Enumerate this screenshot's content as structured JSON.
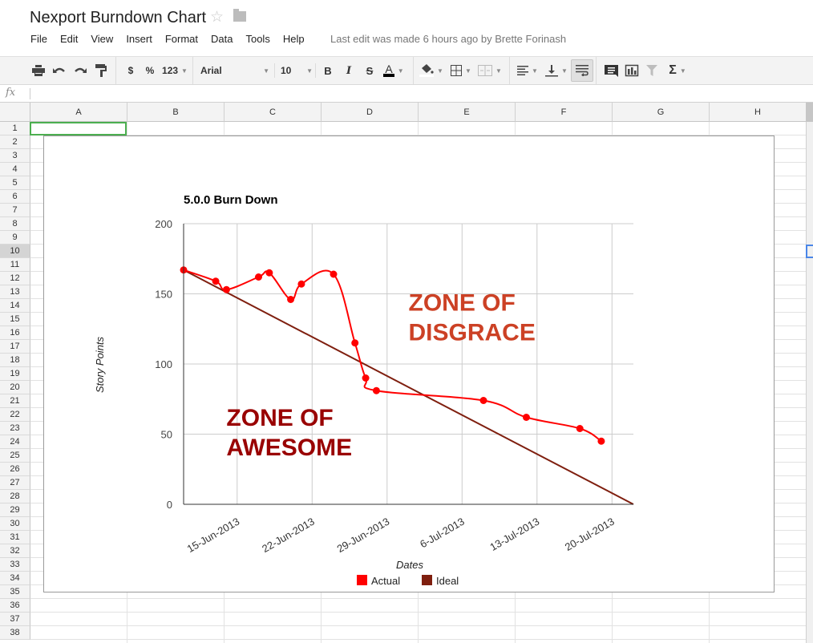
{
  "app": {
    "title": "Nexport Burndown Chart",
    "star_icon": "☆",
    "last_edit": "Last edit was made 6 hours ago by Brette Forinash"
  },
  "menu": [
    "File",
    "Edit",
    "View",
    "Insert",
    "Format",
    "Data",
    "Tools",
    "Help"
  ],
  "toolbar": {
    "currency": "$",
    "percent": "%",
    "number_format": "123",
    "font": "Arial",
    "font_size": "10",
    "bold": "B",
    "italic": "I",
    "strike": "S",
    "text_color": "A",
    "sigma": "Σ"
  },
  "formula_bar": {
    "fx_label": "fx",
    "value": ""
  },
  "columns": [
    "A",
    "B",
    "C",
    "D",
    "E",
    "F",
    "G",
    "H"
  ],
  "rows": [
    "1",
    "2",
    "3",
    "4",
    "5",
    "6",
    "7",
    "8",
    "9",
    "10",
    "11",
    "12",
    "13",
    "14",
    "15",
    "16",
    "17",
    "18",
    "19",
    "20",
    "21",
    "22",
    "23",
    "24",
    "25",
    "26",
    "27",
    "28",
    "29",
    "30",
    "31",
    "32",
    "33",
    "34",
    "35",
    "36",
    "37",
    "38"
  ],
  "selected_row": "10",
  "colors": {
    "actual": "#ff0000",
    "ideal": "#7f1f0f",
    "zone_disgrace": "#cc4125",
    "zone_awesome": "#990000",
    "selection": "#4caf50"
  },
  "chart_data": {
    "type": "line",
    "title": "5.0.0 Burn Down",
    "xlabel": "Dates",
    "ylabel": "Story Points",
    "ylim": [
      0,
      200
    ],
    "yticks": [
      0,
      50,
      100,
      150,
      200
    ],
    "xlim": [
      "2013-06-10",
      "2013-07-22"
    ],
    "xticks": [
      {
        "date": "2013-06-15",
        "label": "15-Jun-2013"
      },
      {
        "date": "2013-06-22",
        "label": "22-Jun-2013"
      },
      {
        "date": "2013-06-29",
        "label": "29-Jun-2013"
      },
      {
        "date": "2013-07-06",
        "label": "6-Jul-2013"
      },
      {
        "date": "2013-07-13",
        "label": "13-Jul-2013"
      },
      {
        "date": "2013-07-20",
        "label": "20-Jul-2013"
      }
    ],
    "grid": true,
    "legend": "bottom",
    "series": [
      {
        "name": "Actual",
        "color": "#ff0000",
        "smooth": true,
        "markers": true,
        "points": [
          {
            "x": "2013-06-10",
            "y": 167
          },
          {
            "x": "2013-06-13",
            "y": 159
          },
          {
            "x": "2013-06-14",
            "y": 153
          },
          {
            "x": "2013-06-17",
            "y": 162
          },
          {
            "x": "2013-06-18",
            "y": 165
          },
          {
            "x": "2013-06-20",
            "y": 146
          },
          {
            "x": "2013-06-21",
            "y": 157
          },
          {
            "x": "2013-06-24",
            "y": 164
          },
          {
            "x": "2013-06-26",
            "y": 115
          },
          {
            "x": "2013-06-27",
            "y": 90
          },
          {
            "x": "2013-06-28",
            "y": 81
          },
          {
            "x": "2013-07-08",
            "y": 74
          },
          {
            "x": "2013-07-12",
            "y": 62
          },
          {
            "x": "2013-07-17",
            "y": 54
          },
          {
            "x": "2013-07-19",
            "y": 45
          }
        ]
      },
      {
        "name": "Ideal",
        "color": "#7f1f0f",
        "smooth": false,
        "markers": false,
        "points": [
          {
            "x": "2013-06-10",
            "y": 167
          },
          {
            "x": "2013-07-22",
            "y": 0
          }
        ]
      }
    ],
    "annotations": [
      {
        "text": [
          "ZONE OF",
          "DISGRACE"
        ],
        "color": "#cc4125",
        "x": "2013-07-01",
        "y": 138
      },
      {
        "text": [
          "ZONE OF",
          "AWESOME"
        ],
        "color": "#990000",
        "x": "2013-06-14",
        "y": 56
      }
    ]
  }
}
